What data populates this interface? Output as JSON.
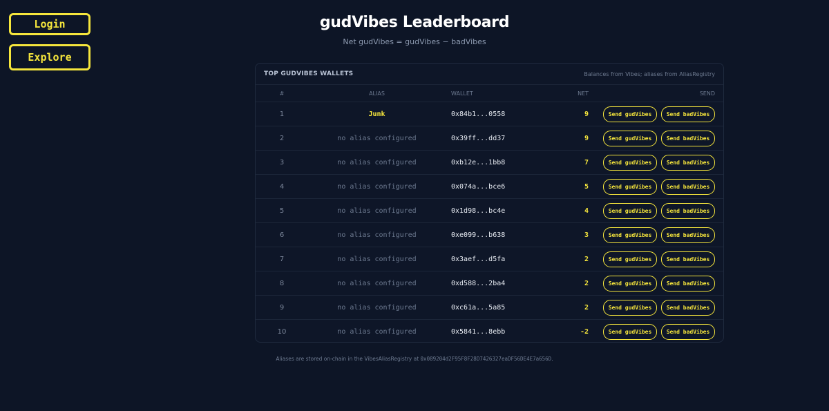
{
  "nav": {
    "login_label": "Login",
    "explore_label": "Explore"
  },
  "header": {
    "title": "gudVibes Leaderboard",
    "subtitle": "Net gudVibes = gudVibes − badVibes"
  },
  "card": {
    "title": "TOP GUDVIBES WALLETS",
    "note": "Balances from Vibes; aliases from AliasRegistry"
  },
  "columns": {
    "rank": "#",
    "alias": "ALIAS",
    "wallet": "WALLET",
    "net": "NET",
    "send": "SEND"
  },
  "buttons": {
    "send_gud": "Send gudVibes",
    "send_bad": "Send badVibes"
  },
  "rows": [
    {
      "rank": "1",
      "alias": "Junk",
      "has_alias": true,
      "wallet": "0x84b1...0558",
      "net": "9"
    },
    {
      "rank": "2",
      "alias": "no alias configured",
      "has_alias": false,
      "wallet": "0x39ff...dd37",
      "net": "9"
    },
    {
      "rank": "3",
      "alias": "no alias configured",
      "has_alias": false,
      "wallet": "0xb12e...1bb8",
      "net": "7"
    },
    {
      "rank": "4",
      "alias": "no alias configured",
      "has_alias": false,
      "wallet": "0x074a...bce6",
      "net": "5"
    },
    {
      "rank": "5",
      "alias": "no alias configured",
      "has_alias": false,
      "wallet": "0x1d98...bc4e",
      "net": "4"
    },
    {
      "rank": "6",
      "alias": "no alias configured",
      "has_alias": false,
      "wallet": "0xe099...b638",
      "net": "3"
    },
    {
      "rank": "7",
      "alias": "no alias configured",
      "has_alias": false,
      "wallet": "0x3aef...d5fa",
      "net": "2"
    },
    {
      "rank": "8",
      "alias": "no alias configured",
      "has_alias": false,
      "wallet": "0xd588...2ba4",
      "net": "2"
    },
    {
      "rank": "9",
      "alias": "no alias configured",
      "has_alias": false,
      "wallet": "0xc61a...5a85",
      "net": "2"
    },
    {
      "rank": "10",
      "alias": "no alias configured",
      "has_alias": false,
      "wallet": "0x5841...8ebb",
      "net": "-2"
    }
  ],
  "footer": {
    "text": "Aliases are stored on-chain in the VibesAliasRegistry at",
    "address": "0x089204d2F95F8F28D7426327eaDF56DE4E7a656D",
    "suffix": "."
  },
  "colors": {
    "background": "#0d1526",
    "accent": "#f6e63c",
    "muted": "#6d7a90"
  }
}
